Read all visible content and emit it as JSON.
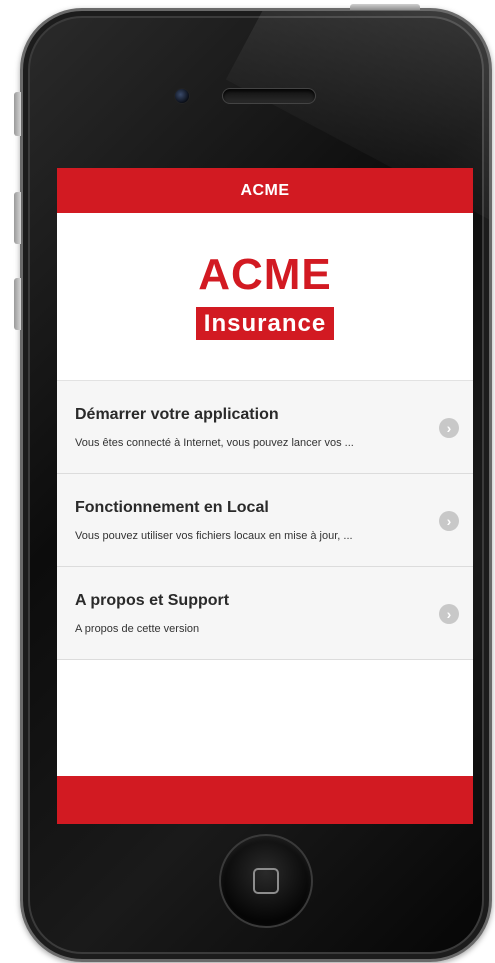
{
  "app": {
    "header_title": "ACME"
  },
  "logo": {
    "top_text": "ACME",
    "bottom_text": "Insurance"
  },
  "menu": {
    "items": [
      {
        "title": "Démarrer votre application",
        "subtitle": "Vous êtes connecté à Internet, vous pouvez lancer vos ..."
      },
      {
        "title": "Fonctionnement en Local",
        "subtitle": "Vous pouvez utiliser vos fichiers locaux en mise à jour, ..."
      },
      {
        "title": "A propos et Support",
        "subtitle": "A propos de cette version"
      }
    ]
  },
  "icons": {
    "chevron": "chevron-right-icon",
    "home": "home-button-icon"
  },
  "colors": {
    "accent": "#d21a22",
    "menu_bg": "#f6f6f6",
    "chevron": "#c8c8c8"
  }
}
